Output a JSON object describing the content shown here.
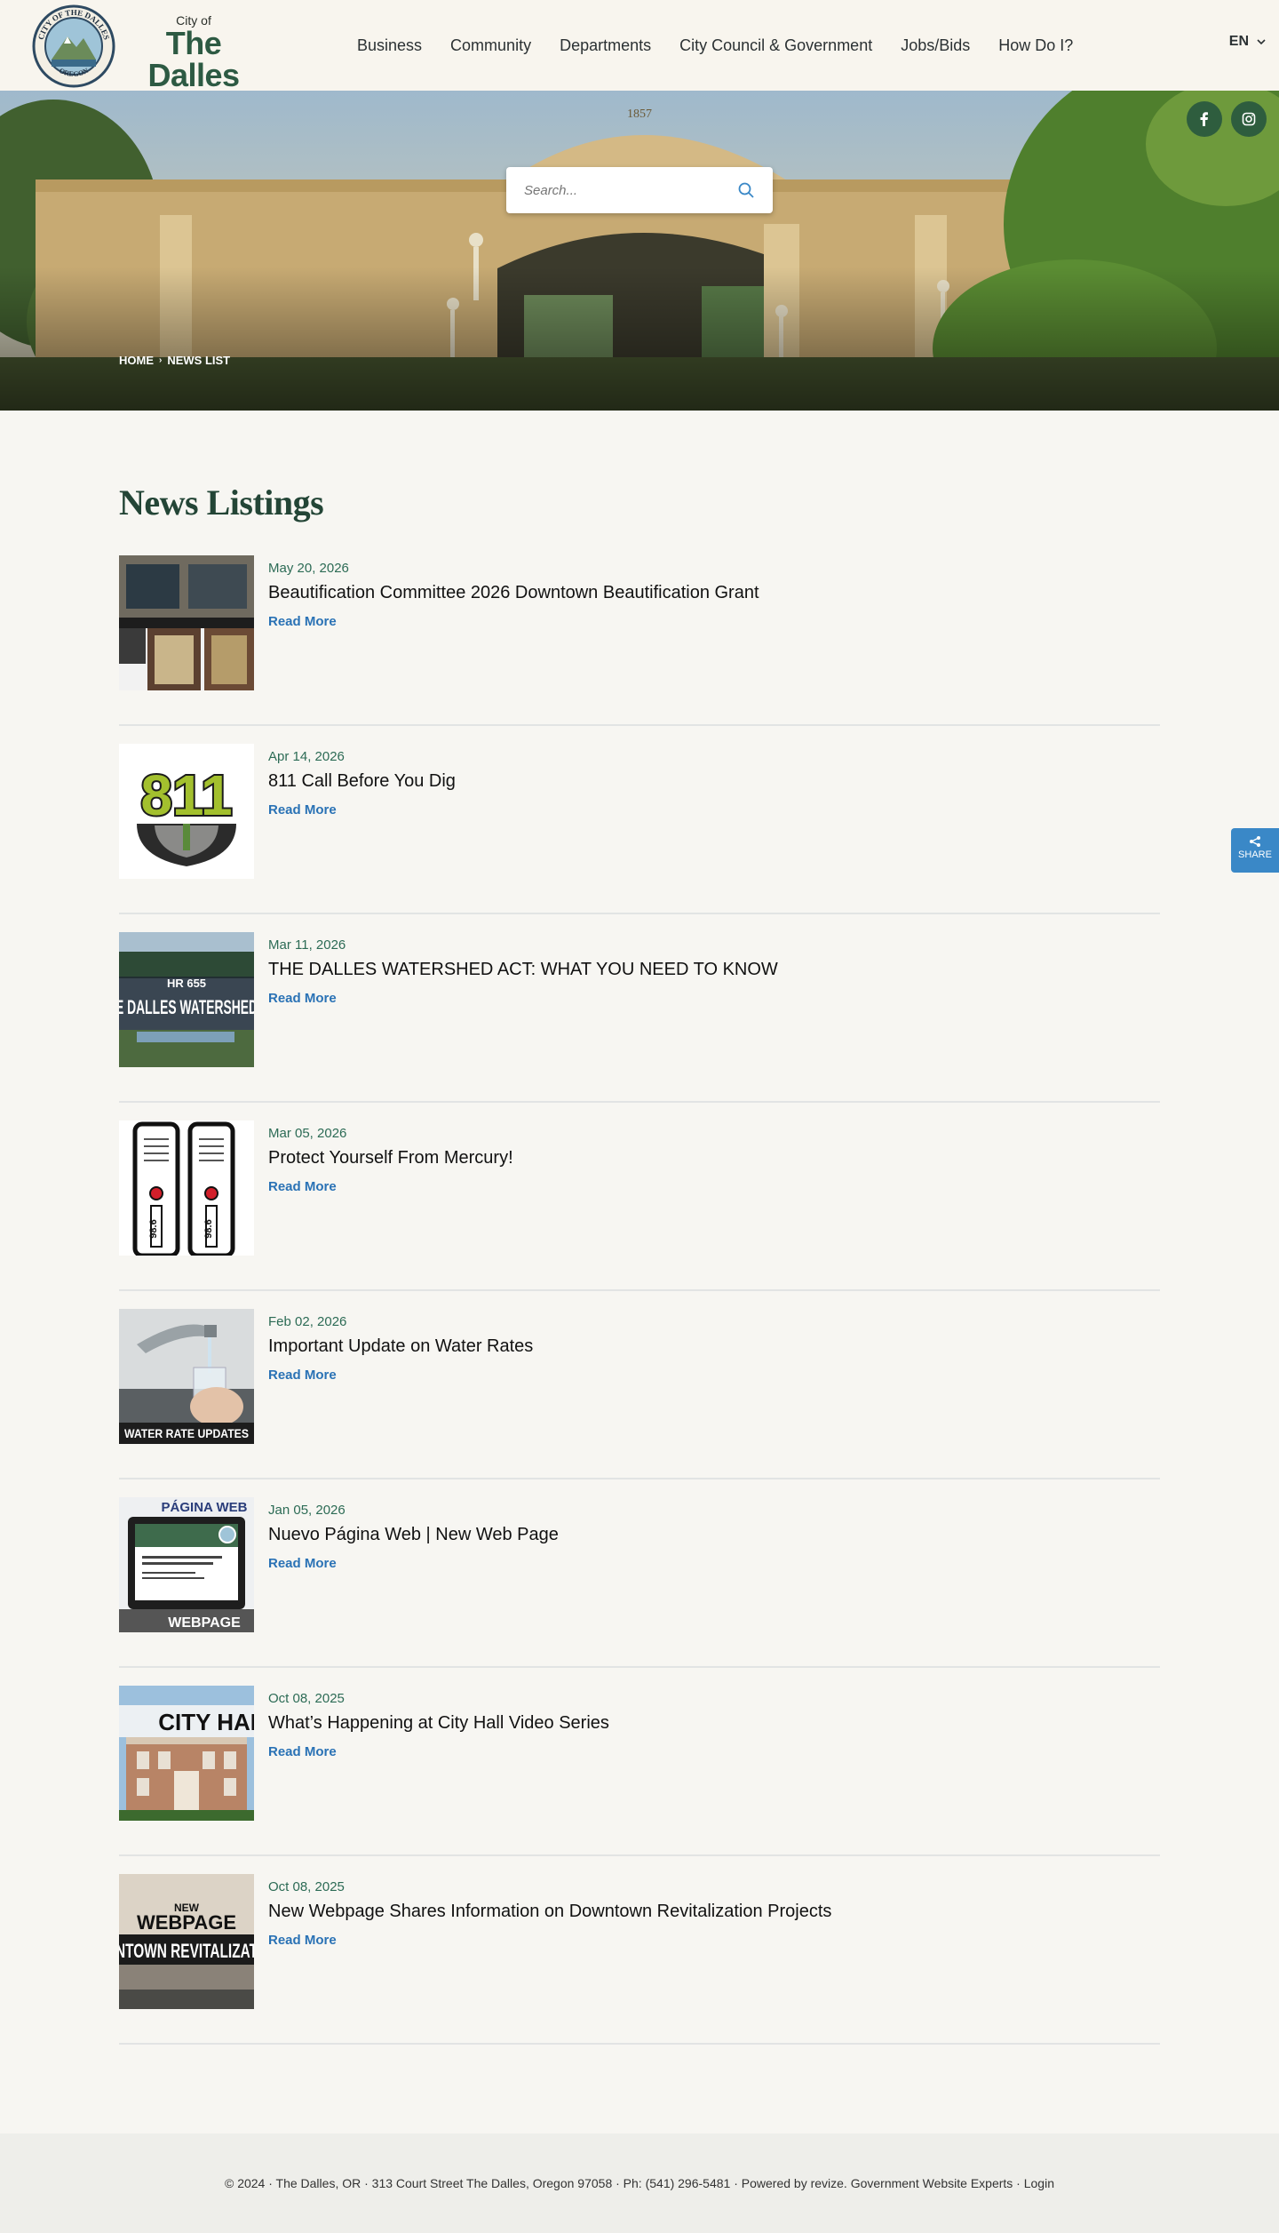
{
  "header": {
    "logo": {
      "city_of": "City of",
      "name": "The Dalles",
      "state": "OREGON",
      "seal_text_top": "CITY OF THE DALLES",
      "seal_text_bottom": "OREGON"
    },
    "nav": [
      "Business",
      "Community",
      "Departments",
      "City Council & Government",
      "Jobs/Bids",
      "How Do I?"
    ],
    "language": "EN"
  },
  "hero": {
    "search_placeholder": "Search...",
    "arch_year": "1857",
    "breadcrumb": [
      "HOME",
      "NEWS LIST"
    ]
  },
  "page_title": "News Listings",
  "news": [
    {
      "date": "May 20, 2026",
      "title": "Beautification Committee 2026 Downtown Beautification Grant",
      "more": "Read More",
      "thumb": "storefront-photo"
    },
    {
      "date": "Apr 14, 2026",
      "title": "811 Call Before You Dig",
      "more": "Read More",
      "thumb": "811-logo",
      "thumb_text": "811"
    },
    {
      "date": "Mar 11, 2026",
      "title": "THE DALLES WATERSHED ACT: WHAT YOU NEED TO KNOW",
      "more": "Read More",
      "thumb": "watershed-photo",
      "thumb_text_1": "HR 655",
      "thumb_text_2": "E DALLES WATERSHED"
    },
    {
      "date": "Mar 05, 2026",
      "title": "Protect Yourself From Mercury!",
      "more": "Read More",
      "thumb": "thermometers",
      "thumb_text_1": "98.6",
      "thumb_text_2": "98.6"
    },
    {
      "date": "Feb 02, 2026",
      "title": "Important Update on Water Rates",
      "more": "Read More",
      "thumb": "water-faucet-photo",
      "thumb_text": "WATER RATE UPDATES"
    },
    {
      "date": "Jan 05, 2026",
      "title": "Nuevo Página Web | New Web Page",
      "more": "Read More",
      "thumb": "laptop-webpage",
      "thumb_text_1": "PÁGINA WEB",
      "thumb_text_2": "WEBPAGE"
    },
    {
      "date": "Oct 08, 2025",
      "title": "What’s Happening at City Hall Video Series",
      "more": "Read More",
      "thumb": "city-hall-photo",
      "thumb_text": "CITY HAL"
    },
    {
      "date": "Oct 08, 2025",
      "title": "New Webpage Shares Information on Downtown Revitalization Projects",
      "more": "Read More",
      "thumb": "revitalization-graphic",
      "thumb_text_1": "NEW",
      "thumb_text_2": "WEBPAGE",
      "thumb_text_3": "NTOWN REVITALIZAT"
    }
  ],
  "share_label": "SHARE",
  "footer": {
    "text": "© 2024 · The Dalles, OR · 313 Court Street The Dalles, Oregon 97058 · Ph: (541) 296-5481 · Powered by revize. Government Website Experts · Login"
  },
  "colors": {
    "brand_green": "#2d5a43",
    "link_blue": "#2a72b5",
    "date_green": "#2c6b55",
    "share_blue": "#3a88c7"
  }
}
